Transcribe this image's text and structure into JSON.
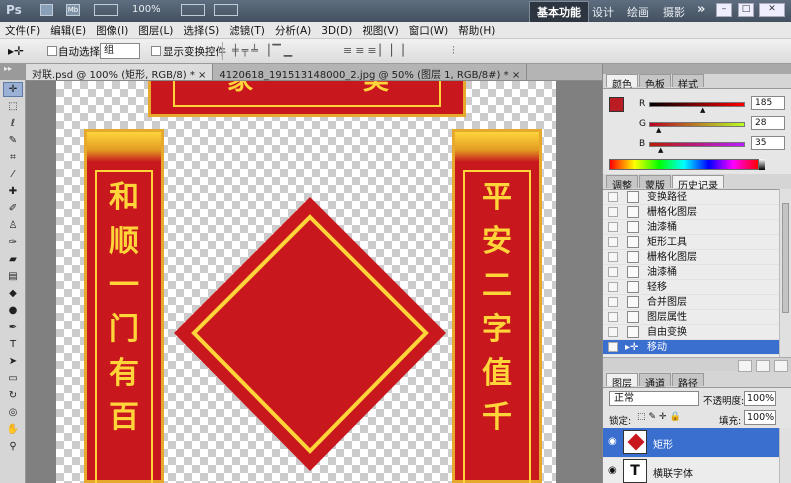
{
  "app": {
    "logo": "Ps",
    "zoom": "100%",
    "workspaces": [
      "基本功能",
      "设计",
      "绘画",
      "摄影"
    ],
    "more": "»"
  },
  "menu": [
    "文件(F)",
    "编辑(E)",
    "图像(I)",
    "图层(L)",
    "选择(S)",
    "滤镜(T)",
    "分析(A)",
    "3D(D)",
    "视图(V)",
    "窗口(W)",
    "帮助(H)"
  ],
  "options": {
    "auto_select_label": "自动选择:",
    "auto_select_value": "组",
    "show_transform_label": "显示变换控件"
  },
  "doc_tabs": [
    {
      "label": "对联.psd @ 100% (矩形, RGB/8) *",
      "close": "×"
    },
    {
      "label": "4120618_191513148000_2.jpg @ 50% (图层 1, RGB/8#) *",
      "close": "×"
    }
  ],
  "couplet": {
    "left_text": [
      "和",
      "顺",
      "一",
      "门",
      "有",
      "百"
    ],
    "right_text": [
      "平",
      "安",
      "二",
      "字",
      "值",
      "千"
    ],
    "top_text": [
      "家",
      "美"
    ]
  },
  "colors": {
    "couplet_red": "#c8181e",
    "couplet_gold": "#ffd53a",
    "foreground": "#b91c23",
    "selection": "#3b6fcf"
  },
  "color_panel": {
    "tabs": [
      "颜色",
      "色板",
      "样式"
    ],
    "r_label": "R",
    "r_value": "185",
    "g_label": "G",
    "g_value": "28",
    "b_label": "B",
    "b_value": "35"
  },
  "history_panel": {
    "tabs": [
      "调整",
      "蒙版",
      "历史记录"
    ],
    "items": [
      "变换路径",
      "栅格化图层",
      "油漆桶",
      "矩形工具",
      "栅格化图层",
      "油漆桶",
      "轻移",
      "合并图层",
      "图层属性",
      "自由变换",
      "移动"
    ]
  },
  "layers_panel": {
    "tabs": [
      "图层",
      "通道",
      "路径"
    ],
    "blend_mode": "正常",
    "opacity_label": "不透明度:",
    "opacity_value": "100%",
    "lock_label": "锁定:",
    "fill_label": "填充:",
    "fill_value": "100%",
    "layers": [
      {
        "name": "矩形",
        "selected": true
      },
      {
        "name": "横联字体",
        "selected": false
      }
    ],
    "text_layer_glyph": "T"
  },
  "tools": [
    "move-tool",
    "marquee-tool",
    "lasso-tool",
    "quick-select-tool",
    "crop-tool",
    "eyedropper-tool",
    "healing-tool",
    "brush-tool",
    "clone-stamp-tool",
    "history-brush-tool",
    "eraser-tool",
    "gradient-tool",
    "blur-tool",
    "dodge-tool",
    "pen-tool",
    "type-tool",
    "path-select-tool",
    "shape-tool",
    "3d-rotate-tool",
    "3d-orbit-tool",
    "hand-tool",
    "zoom-tool"
  ]
}
